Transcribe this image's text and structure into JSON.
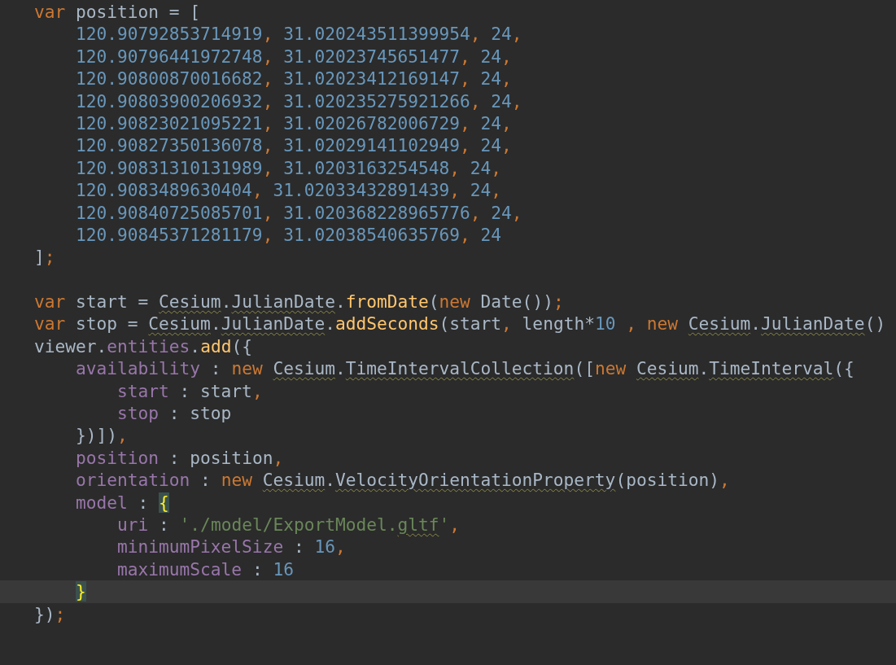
{
  "editor": {
    "lines": [
      {
        "current": false,
        "tokens": [
          {
            "kind": "keyword",
            "text": "var",
            "underlined": false
          },
          {
            "kind": "plain",
            "text": " position = [",
            "underlined": false
          }
        ]
      },
      {
        "current": false,
        "tokens": [
          {
            "kind": "number",
            "text": "    120.90792853714919",
            "underlined": false
          },
          {
            "kind": "punct",
            "text": ", ",
            "underlined": false
          },
          {
            "kind": "number",
            "text": "31.020243511399954",
            "underlined": false
          },
          {
            "kind": "punct",
            "text": ", ",
            "underlined": false
          },
          {
            "kind": "number",
            "text": "24",
            "underlined": false
          },
          {
            "kind": "punct",
            "text": ",",
            "underlined": false
          }
        ]
      },
      {
        "current": false,
        "tokens": [
          {
            "kind": "number",
            "text": "    120.90796441972748",
            "underlined": false
          },
          {
            "kind": "punct",
            "text": ", ",
            "underlined": false
          },
          {
            "kind": "number",
            "text": "31.02023745651477",
            "underlined": false
          },
          {
            "kind": "punct",
            "text": ", ",
            "underlined": false
          },
          {
            "kind": "number",
            "text": "24",
            "underlined": false
          },
          {
            "kind": "punct",
            "text": ",",
            "underlined": false
          }
        ]
      },
      {
        "current": false,
        "tokens": [
          {
            "kind": "number",
            "text": "    120.90800870016682",
            "underlined": false
          },
          {
            "kind": "punct",
            "text": ", ",
            "underlined": false
          },
          {
            "kind": "number",
            "text": "31.02023412169147",
            "underlined": false
          },
          {
            "kind": "punct",
            "text": ", ",
            "underlined": false
          },
          {
            "kind": "number",
            "text": "24",
            "underlined": false
          },
          {
            "kind": "punct",
            "text": ",",
            "underlined": false
          }
        ]
      },
      {
        "current": false,
        "tokens": [
          {
            "kind": "number",
            "text": "    120.90803900206932",
            "underlined": false
          },
          {
            "kind": "punct",
            "text": ", ",
            "underlined": false
          },
          {
            "kind": "number",
            "text": "31.020235275921266",
            "underlined": false
          },
          {
            "kind": "punct",
            "text": ", ",
            "underlined": false
          },
          {
            "kind": "number",
            "text": "24",
            "underlined": false
          },
          {
            "kind": "punct",
            "text": ",",
            "underlined": false
          }
        ]
      },
      {
        "current": false,
        "tokens": [
          {
            "kind": "number",
            "text": "    120.90823021095221",
            "underlined": false
          },
          {
            "kind": "punct",
            "text": ", ",
            "underlined": false
          },
          {
            "kind": "number",
            "text": "31.02026782006729",
            "underlined": false
          },
          {
            "kind": "punct",
            "text": ", ",
            "underlined": false
          },
          {
            "kind": "number",
            "text": "24",
            "underlined": false
          },
          {
            "kind": "punct",
            "text": ",",
            "underlined": false
          }
        ]
      },
      {
        "current": false,
        "tokens": [
          {
            "kind": "number",
            "text": "    120.90827350136078",
            "underlined": false
          },
          {
            "kind": "punct",
            "text": ", ",
            "underlined": false
          },
          {
            "kind": "number",
            "text": "31.02029141102949",
            "underlined": false
          },
          {
            "kind": "punct",
            "text": ", ",
            "underlined": false
          },
          {
            "kind": "number",
            "text": "24",
            "underlined": false
          },
          {
            "kind": "punct",
            "text": ",",
            "underlined": false
          }
        ]
      },
      {
        "current": false,
        "tokens": [
          {
            "kind": "number",
            "text": "    120.90831310131989",
            "underlined": false
          },
          {
            "kind": "punct",
            "text": ", ",
            "underlined": false
          },
          {
            "kind": "number",
            "text": "31.0203163254548",
            "underlined": false
          },
          {
            "kind": "punct",
            "text": ", ",
            "underlined": false
          },
          {
            "kind": "number",
            "text": "24",
            "underlined": false
          },
          {
            "kind": "punct",
            "text": ",",
            "underlined": false
          }
        ]
      },
      {
        "current": false,
        "tokens": [
          {
            "kind": "number",
            "text": "    120.9083489630404",
            "underlined": false
          },
          {
            "kind": "punct",
            "text": ", ",
            "underlined": false
          },
          {
            "kind": "number",
            "text": "31.02033432891439",
            "underlined": false
          },
          {
            "kind": "punct",
            "text": ", ",
            "underlined": false
          },
          {
            "kind": "number",
            "text": "24",
            "underlined": false
          },
          {
            "kind": "punct",
            "text": ",",
            "underlined": false
          }
        ]
      },
      {
        "current": false,
        "tokens": [
          {
            "kind": "number",
            "text": "    120.90840725085701",
            "underlined": false
          },
          {
            "kind": "punct",
            "text": ", ",
            "underlined": false
          },
          {
            "kind": "number",
            "text": "31.020368228965776",
            "underlined": false
          },
          {
            "kind": "punct",
            "text": ", ",
            "underlined": false
          },
          {
            "kind": "number",
            "text": "24",
            "underlined": false
          },
          {
            "kind": "punct",
            "text": ",",
            "underlined": false
          }
        ]
      },
      {
        "current": false,
        "tokens": [
          {
            "kind": "number",
            "text": "    120.90845371281179",
            "underlined": false
          },
          {
            "kind": "punct",
            "text": ", ",
            "underlined": false
          },
          {
            "kind": "number",
            "text": "31.02038540635769",
            "underlined": false
          },
          {
            "kind": "punct",
            "text": ", ",
            "underlined": false
          },
          {
            "kind": "number",
            "text": "24",
            "underlined": false
          }
        ]
      },
      {
        "current": false,
        "tokens": [
          {
            "kind": "plain",
            "text": "]",
            "underlined": false
          },
          {
            "kind": "punct",
            "text": ";",
            "underlined": false
          }
        ]
      },
      {
        "current": false
      },
      {
        "current": false,
        "tokens": [
          {
            "kind": "keyword",
            "text": "var",
            "underlined": false
          },
          {
            "kind": "plain",
            "text": " start = ",
            "underlined": false
          },
          {
            "kind": "plain",
            "text": "Cesium",
            "underlined": true
          },
          {
            "kind": "plain",
            "text": ".",
            "underlined": false
          },
          {
            "kind": "plain",
            "text": "JulianDate",
            "underlined": true
          },
          {
            "kind": "plain",
            "text": ".",
            "underlined": false
          },
          {
            "kind": "function",
            "text": "fromDate",
            "underlined": false
          },
          {
            "kind": "plain",
            "text": "(",
            "underlined": false
          },
          {
            "kind": "keyword",
            "text": "new",
            "underlined": false
          },
          {
            "kind": "plain",
            "text": " Date())",
            "underlined": false
          },
          {
            "kind": "punct",
            "text": ";",
            "underlined": false
          }
        ]
      },
      {
        "current": false,
        "tokens": [
          {
            "kind": "keyword",
            "text": "var",
            "underlined": false
          },
          {
            "kind": "plain",
            "text": " stop = ",
            "underlined": false
          },
          {
            "kind": "plain",
            "text": "Cesium",
            "underlined": true
          },
          {
            "kind": "plain",
            "text": ".",
            "underlined": false
          },
          {
            "kind": "plain",
            "text": "JulianDate",
            "underlined": true
          },
          {
            "kind": "plain",
            "text": ".",
            "underlined": false
          },
          {
            "kind": "function",
            "text": "addSeconds",
            "underlined": false
          },
          {
            "kind": "plain",
            "text": "(start",
            "underlined": false
          },
          {
            "kind": "punct",
            "text": ",",
            "underlined": false
          },
          {
            "kind": "plain",
            "text": " length*",
            "underlined": false
          },
          {
            "kind": "number",
            "text": "10",
            "underlined": false
          },
          {
            "kind": "punct",
            "text": " , ",
            "underlined": false
          },
          {
            "kind": "keyword",
            "text": "new ",
            "underlined": false
          },
          {
            "kind": "plain",
            "text": "Cesium",
            "underlined": true
          },
          {
            "kind": "plain",
            "text": ".",
            "underlined": false
          },
          {
            "kind": "plain",
            "text": "JulianDate",
            "underlined": true
          },
          {
            "kind": "plain",
            "text": "()",
            "underlined": false
          }
        ]
      },
      {
        "current": false,
        "tokens": [
          {
            "kind": "plain",
            "text": "viewer.",
            "underlined": false
          },
          {
            "kind": "property",
            "text": "entities",
            "underlined": false
          },
          {
            "kind": "plain",
            "text": ".",
            "underlined": false
          },
          {
            "kind": "function",
            "text": "add",
            "underlined": false
          },
          {
            "kind": "plain",
            "text": "({",
            "underlined": false
          }
        ]
      },
      {
        "current": false,
        "tokens": [
          {
            "kind": "property",
            "text": "    availability",
            "underlined": false
          },
          {
            "kind": "plain",
            "text": " : ",
            "underlined": false
          },
          {
            "kind": "keyword",
            "text": "new ",
            "underlined": false
          },
          {
            "kind": "plain",
            "text": "Cesium",
            "underlined": true
          },
          {
            "kind": "plain",
            "text": ".",
            "underlined": false
          },
          {
            "kind": "plain",
            "text": "TimeIntervalCollection",
            "underlined": true
          },
          {
            "kind": "plain",
            "text": "([",
            "underlined": false
          },
          {
            "kind": "keyword",
            "text": "new ",
            "underlined": false
          },
          {
            "kind": "plain",
            "text": "Cesium",
            "underlined": true
          },
          {
            "kind": "plain",
            "text": ".",
            "underlined": false
          },
          {
            "kind": "plain",
            "text": "TimeInterval",
            "underlined": true
          },
          {
            "kind": "plain",
            "text": "({",
            "underlined": false
          }
        ]
      },
      {
        "current": false,
        "tokens": [
          {
            "kind": "property",
            "text": "        start",
            "underlined": false
          },
          {
            "kind": "plain",
            "text": " : start",
            "underlined": false
          },
          {
            "kind": "punct",
            "text": ",",
            "underlined": false
          }
        ]
      },
      {
        "current": false,
        "tokens": [
          {
            "kind": "property",
            "text": "        stop",
            "underlined": false
          },
          {
            "kind": "plain",
            "text": " : stop",
            "underlined": false
          }
        ]
      },
      {
        "current": false,
        "tokens": [
          {
            "kind": "plain",
            "text": "    })])",
            "underlined": false
          },
          {
            "kind": "punct",
            "text": ",",
            "underlined": false
          }
        ]
      },
      {
        "current": false,
        "tokens": [
          {
            "kind": "property",
            "text": "    position",
            "underlined": false
          },
          {
            "kind": "plain",
            "text": " : position",
            "underlined": false
          },
          {
            "kind": "punct",
            "text": ",",
            "underlined": false
          }
        ]
      },
      {
        "current": false,
        "tokens": [
          {
            "kind": "property",
            "text": "    orientation",
            "underlined": false
          },
          {
            "kind": "plain",
            "text": " : ",
            "underlined": false
          },
          {
            "kind": "keyword",
            "text": "new ",
            "underlined": false
          },
          {
            "kind": "plain",
            "text": "Cesium",
            "underlined": true
          },
          {
            "kind": "plain",
            "text": ".",
            "underlined": false
          },
          {
            "kind": "plain",
            "text": "VelocityOrientationProperty",
            "underlined": true
          },
          {
            "kind": "plain",
            "text": "(position)",
            "underlined": false
          },
          {
            "kind": "punct",
            "text": ",",
            "underlined": false
          }
        ]
      },
      {
        "current": false,
        "tokens": [
          {
            "kind": "property",
            "text": "    model",
            "underlined": false
          },
          {
            "kind": "plain",
            "text": " : ",
            "underlined": false
          },
          {
            "kind": "brace_match",
            "text": "{",
            "underlined": false
          }
        ]
      },
      {
        "current": false,
        "tokens": [
          {
            "kind": "property",
            "text": "        uri",
            "underlined": false
          },
          {
            "kind": "plain",
            "text": " : ",
            "underlined": false
          },
          {
            "kind": "string",
            "text": "'./model/ExportModel.",
            "underlined": false
          },
          {
            "kind": "string",
            "text": "gltf",
            "underlined": true
          },
          {
            "kind": "string",
            "text": "'",
            "underlined": false
          },
          {
            "kind": "punct",
            "text": ",",
            "underlined": false
          }
        ]
      },
      {
        "current": false,
        "tokens": [
          {
            "kind": "property",
            "text": "        minimumPixelSize",
            "underlined": false
          },
          {
            "kind": "plain",
            "text": " : ",
            "underlined": false
          },
          {
            "kind": "number",
            "text": "16",
            "underlined": false
          },
          {
            "kind": "punct",
            "text": ",",
            "underlined": false
          }
        ]
      },
      {
        "current": false,
        "tokens": [
          {
            "kind": "property",
            "text": "        maximumScale",
            "underlined": false
          },
          {
            "kind": "plain",
            "text": " : ",
            "underlined": false
          },
          {
            "kind": "number",
            "text": "16",
            "underlined": false
          }
        ]
      },
      {
        "current": true,
        "tokens": [
          {
            "kind": "brace_match",
            "text": "    }",
            "underlined": false
          }
        ]
      },
      {
        "current": false,
        "tokens": [
          {
            "kind": "plain",
            "text": "})",
            "underlined": false
          },
          {
            "kind": "punct",
            "text": ";",
            "underlined": false
          }
        ]
      }
    ]
  }
}
